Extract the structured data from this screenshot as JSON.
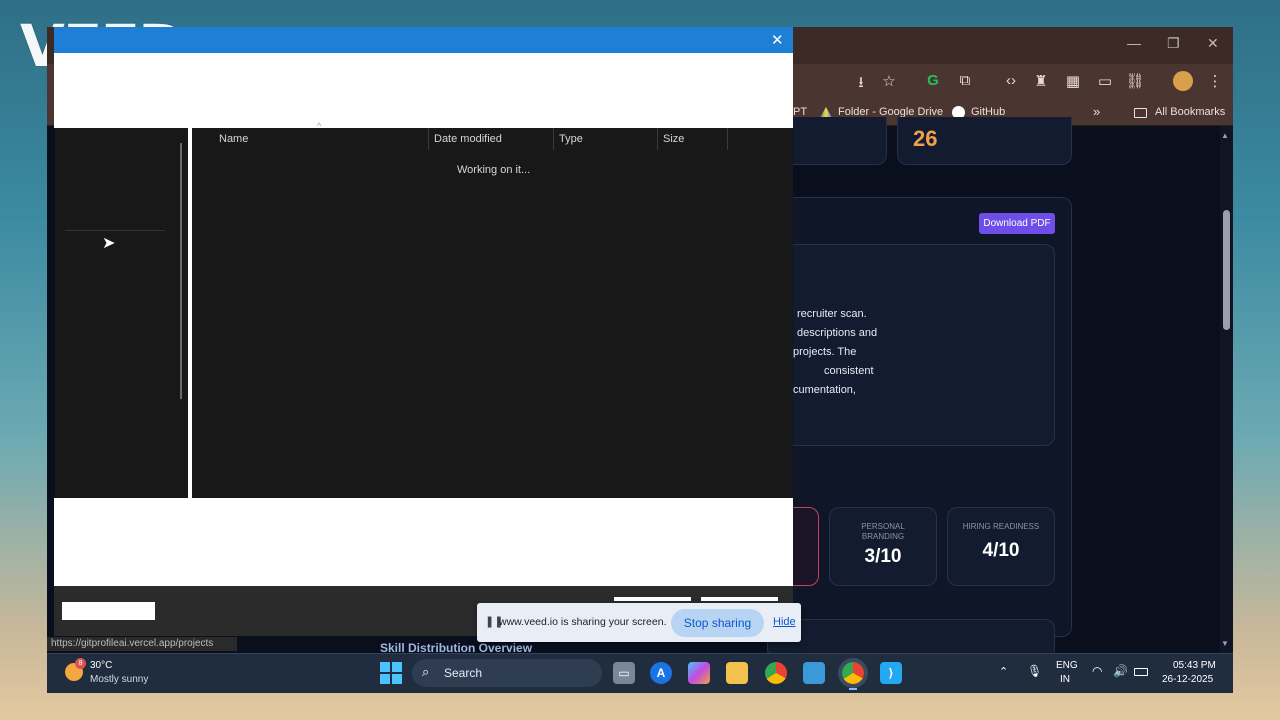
{
  "watermark": "VEED",
  "browser": {
    "toolbar_icons": [
      "download-icon",
      "star-icon",
      "grammarly-icon",
      "extensions-icon",
      "code-icon",
      "privacy-icon",
      "apps-icon",
      "reader-icon",
      "link-icon",
      "profile-icon",
      "menu-icon"
    ],
    "bookmarks": {
      "partial": "PT",
      "drive": "Folder - Google Drive",
      "github": "GitHub",
      "overflow": "»",
      "all": "All Bookmarks"
    }
  },
  "page": {
    "stat_value": "26",
    "download_pdf": "Download PDF",
    "summary_lines": [
      "recruiter scan.",
      "descriptions and",
      "projects. The",
      "consistent",
      "cumentation,"
    ],
    "metrics": [
      {
        "label": "PERSONAL BRANDING",
        "value": "3/10"
      },
      {
        "label": "HIRING READINESS",
        "value": "4/10"
      }
    ],
    "partial_heading": "Skill Distribution Overview",
    "status_url": "https://gitprofileai.vercel.app/projects"
  },
  "dialog": {
    "columns": [
      "Name",
      "Date modified",
      "Type",
      "Size"
    ],
    "loading": "Working on it..."
  },
  "sharebar": {
    "message": "www.veed.io is sharing your screen.",
    "stop": "Stop sharing",
    "hide": "Hide"
  },
  "taskbar": {
    "weather_badge": "8",
    "temperature": "30°C",
    "condition": "Mostly sunny",
    "search": "Search",
    "lang_top": "ENG",
    "lang_bottom": "IN",
    "time": "05:43 PM",
    "date": "26-12-2025"
  },
  "colors": {
    "accent_purple": "#6d4ee8",
    "dialog_blue": "#1e7fd6",
    "stop_button": "#b8d4f3"
  }
}
